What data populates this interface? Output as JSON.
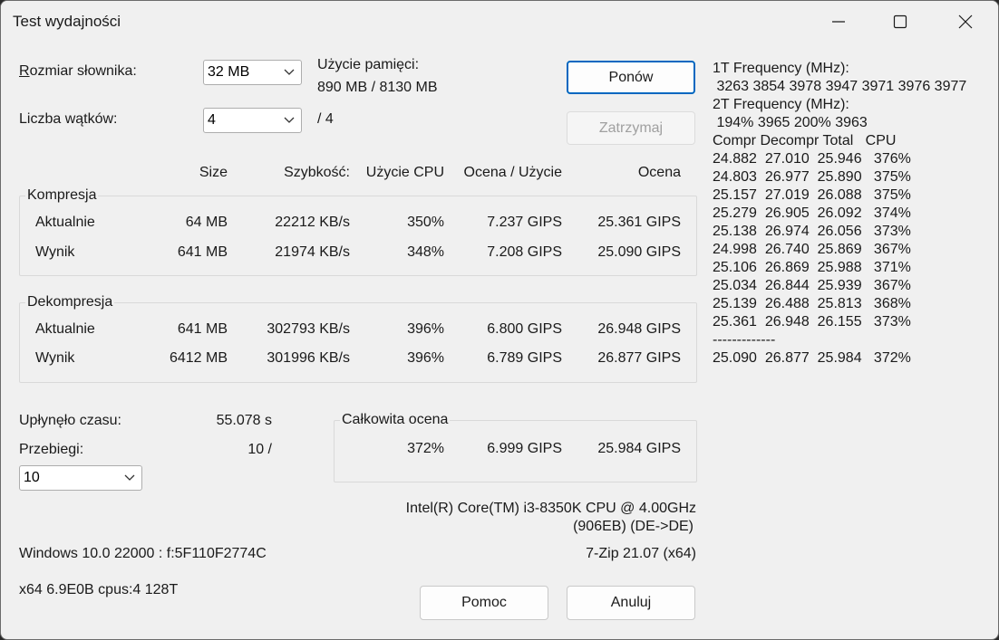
{
  "window": {
    "title": "Test wydajności"
  },
  "settings": {
    "dict_label_prefix": "R",
    "dict_label_rest": "ozmiar słownika:",
    "dict_value": "32 MB",
    "threads_label": "Liczba wątków:",
    "threads_value": "4",
    "threads_total": "/ 4",
    "memory_label": "Użycie pamięci:",
    "memory_value": "890 MB / 8130 MB"
  },
  "buttons": {
    "restart": "Ponów",
    "stop": "Zatrzymaj",
    "help": "Pomoc",
    "cancel": "Anuluj"
  },
  "table": {
    "headers": {
      "size": "Size",
      "speed": "Szybkość:",
      "cpu": "Użycie CPU",
      "rating_usage": "Ocena / Użycie",
      "rating": "Ocena"
    },
    "compression": {
      "title": "Kompresja",
      "current": {
        "label": "Aktualnie",
        "size": "64 MB",
        "speed": "22212 KB/s",
        "cpu": "350%",
        "rating_usage": "7.237 GIPS",
        "rating": "25.361 GIPS"
      },
      "result": {
        "label": "Wynik",
        "size": "641 MB",
        "speed": "21974 KB/s",
        "cpu": "348%",
        "rating_usage": "7.208 GIPS",
        "rating": "25.090 GIPS"
      }
    },
    "decompression": {
      "title": "Dekompresja",
      "current": {
        "label": "Aktualnie",
        "size": "641 MB",
        "speed": "302793 KB/s",
        "cpu": "396%",
        "rating_usage": "6.800 GIPS",
        "rating": "26.948 GIPS"
      },
      "result": {
        "label": "Wynik",
        "size": "6412 MB",
        "speed": "301996 KB/s",
        "cpu": "396%",
        "rating_usage": "6.789 GIPS",
        "rating": "26.877 GIPS"
      }
    }
  },
  "timing": {
    "elapsed_label": "Upłynęło czasu:",
    "elapsed_value": "55.078 s",
    "passes_label": "Przebiegi:",
    "passes_value": "10 /",
    "passes_select": "10"
  },
  "total": {
    "title": "Całkowita ocena",
    "cpu": "372%",
    "rating_usage": "6.999 GIPS",
    "rating": "25.984 GIPS"
  },
  "system": {
    "cpu_line1": "Intel(R) Core(TM) i3-8350K CPU @ 4.00GHz",
    "cpu_line2": "(906EB) (DE->DE)",
    "os": "Windows 10.0 22000 :  f:5F110F2774C",
    "version": "7-Zip 21.07 (x64)",
    "arch": "x64 6.9E0B cpus:4 128T"
  },
  "log": {
    "freq1_label": "1T Frequency (MHz):",
    "freq1_values": " 3263 3854 3978 3947 3971 3976 3977",
    "freq2_label": "2T Frequency (MHz):",
    "freq2_values": " 194% 3965 200% 3963",
    "header": "Compr Decompr Total   CPU",
    "rows": [
      "24.882  27.010  25.946   376%",
      "24.803  26.977  25.890   375%",
      "25.157  27.019  26.088   375%",
      "25.279  26.905  26.092   374%",
      "25.138  26.974  26.056   373%",
      "24.998  26.740  25.869   367%",
      "25.106  26.869  25.988   371%",
      "25.034  26.844  25.939   367%",
      "25.139  26.488  25.813   368%",
      "25.361  26.948  26.155   373%"
    ],
    "separator": "-------------",
    "summary": "25.090  26.877  25.984   372%"
  }
}
